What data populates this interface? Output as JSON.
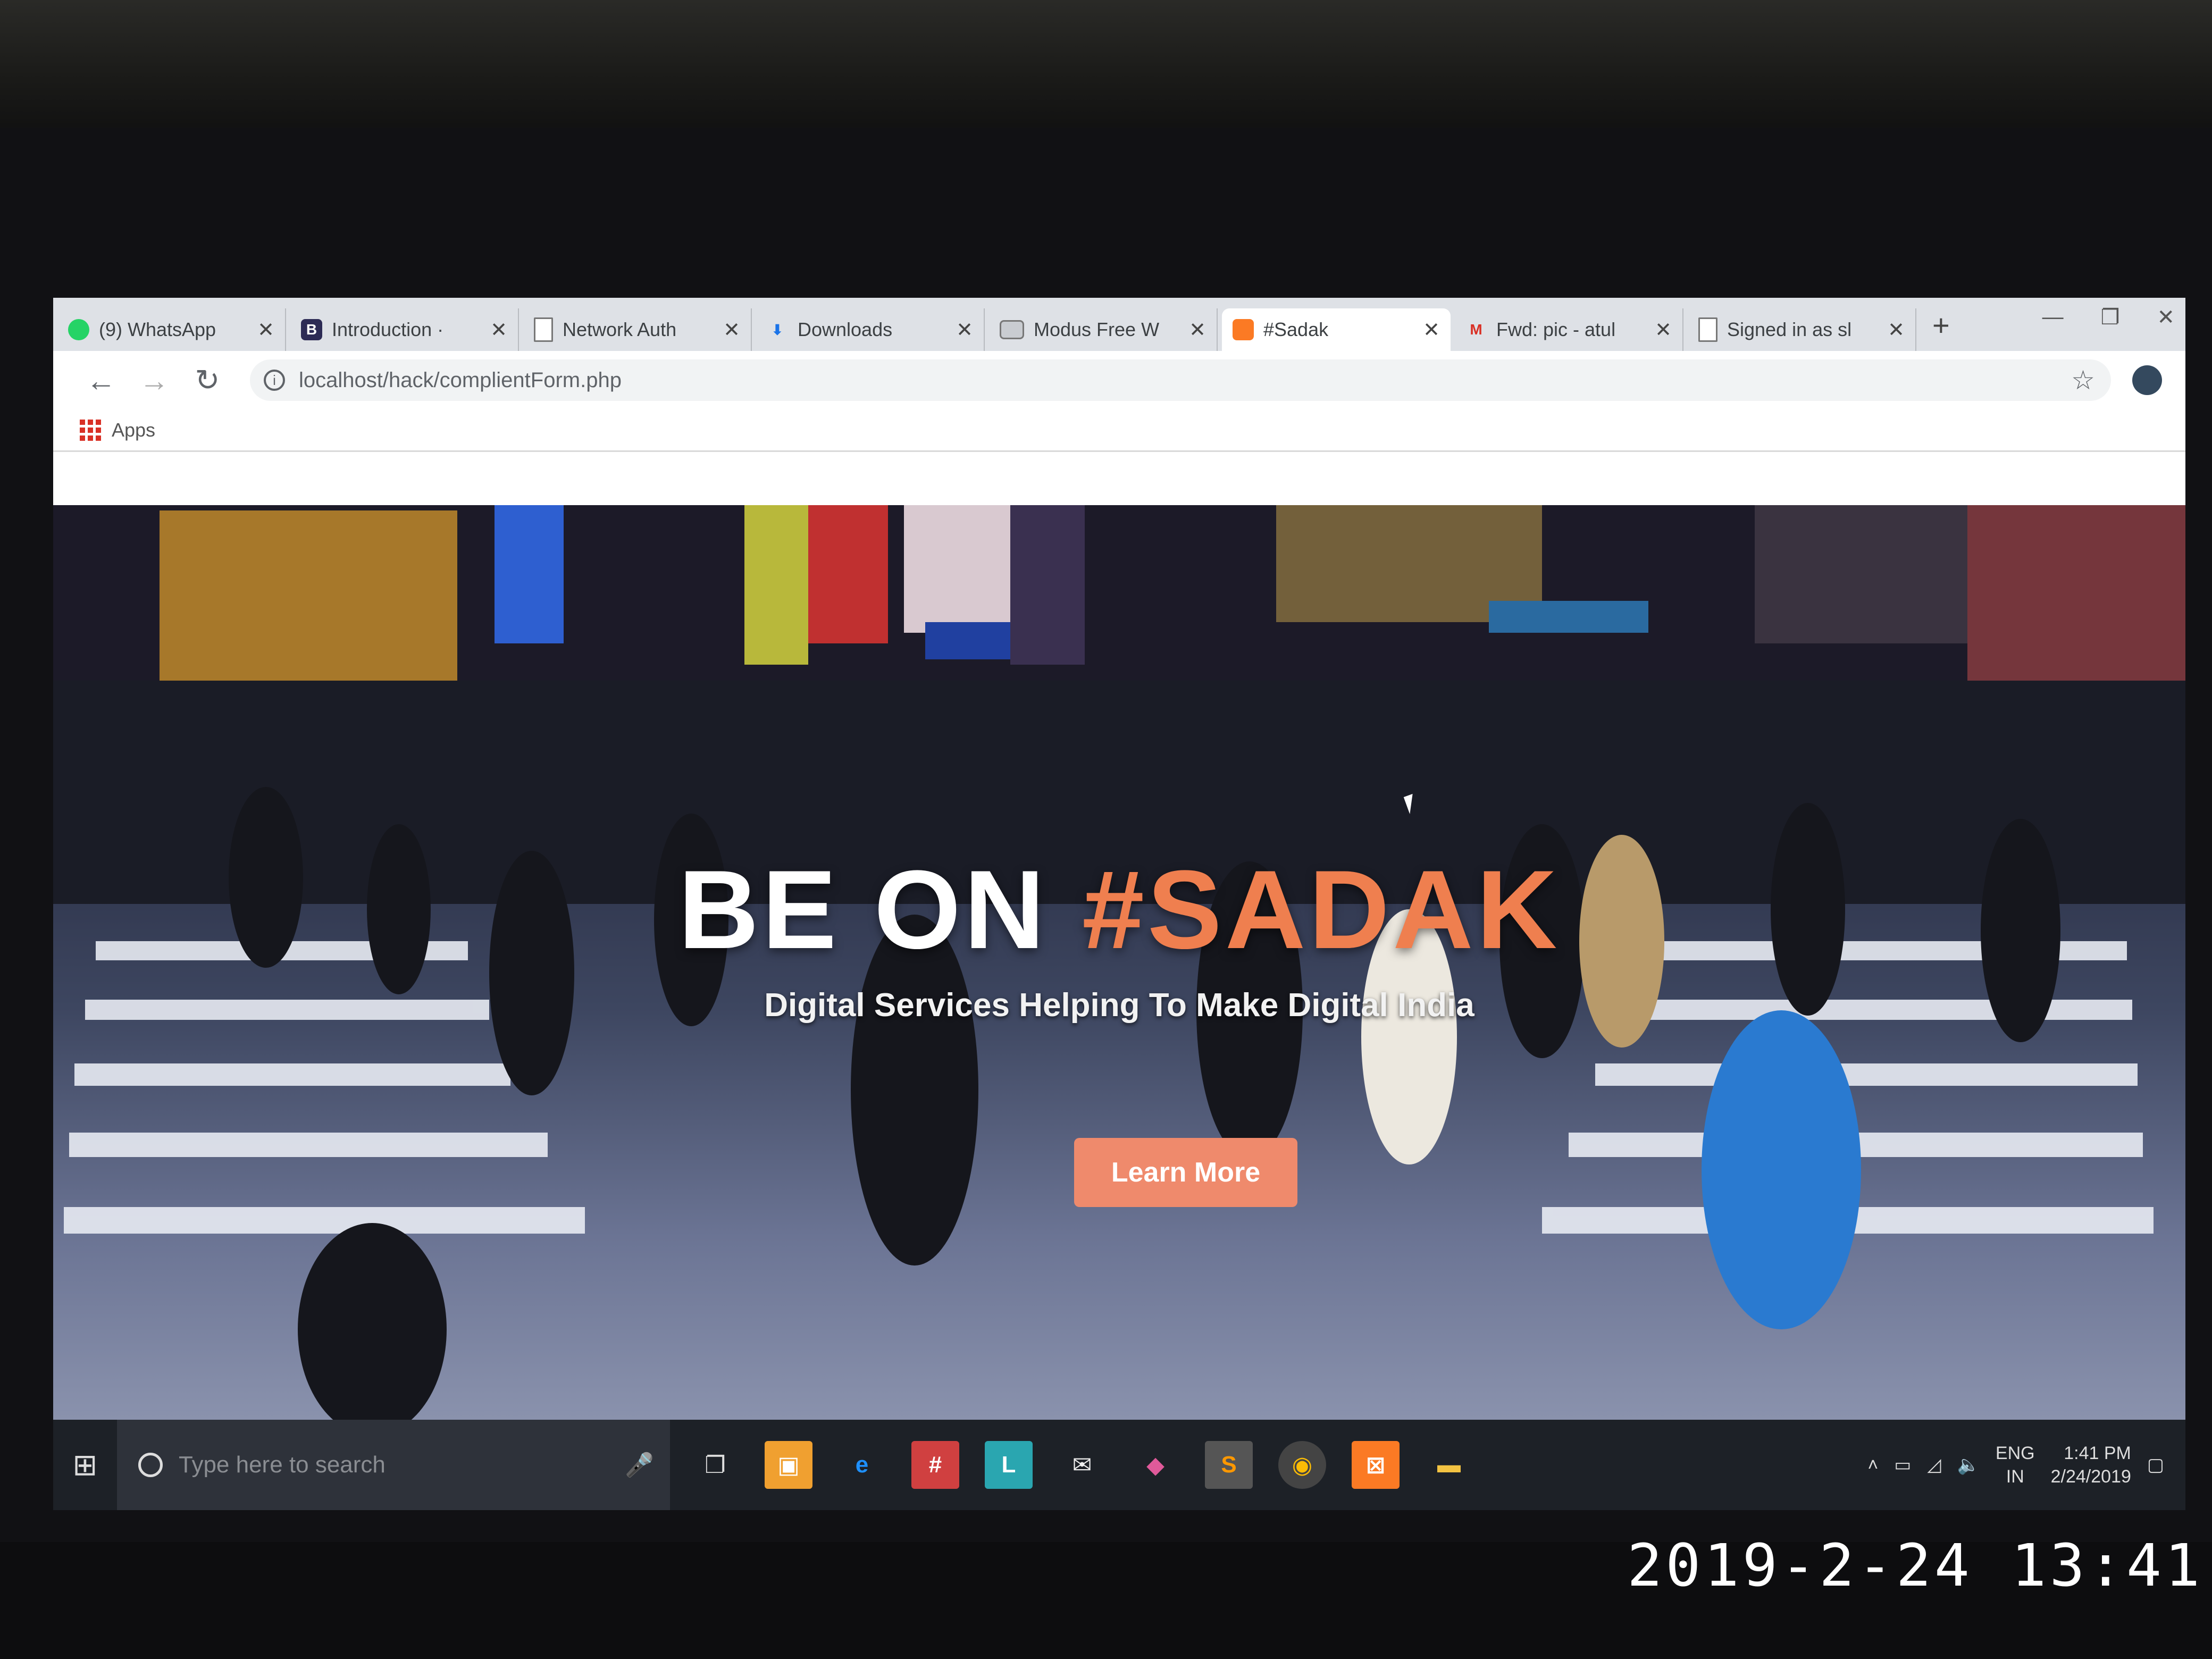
{
  "browser": {
    "tabs": [
      {
        "title": "(9) WhatsApp",
        "icon": "whatsapp-icon",
        "color": "#25d366",
        "glyph": "",
        "active": false
      },
      {
        "title": "Introduction ·",
        "icon": "bootstrap-icon",
        "color": "#2d2b55",
        "glyph": "B",
        "active": false
      },
      {
        "title": "Network Auth",
        "icon": "page-icon",
        "color": "#9aa0a6",
        "glyph": "",
        "active": false
      },
      {
        "title": "Downloads",
        "icon": "download-icon",
        "color": "#1a73e8",
        "glyph": "⬇",
        "active": false
      },
      {
        "title": "Modus Free W",
        "icon": "site-icon",
        "color": "#9aa0a6",
        "glyph": "",
        "active": false
      },
      {
        "title": "#Sadak",
        "icon": "xampp-icon",
        "color": "#fb7a24",
        "glyph": "",
        "active": true
      },
      {
        "title": "Fwd: pic - atul",
        "icon": "gmail-icon",
        "color": "#d93025",
        "glyph": "M",
        "active": false
      },
      {
        "title": "Signed in as sl",
        "icon": "page-icon",
        "color": "#9aa0a6",
        "glyph": "",
        "active": false
      }
    ],
    "new_tab": "+",
    "url": "localhost/hack/complientForm.php",
    "bookmarks_apps": "Apps"
  },
  "hero": {
    "title_white": "BE ON ",
    "title_accent": "#SADAK",
    "subtitle": "Digital Services Helping To Make Digital India",
    "button": "Learn More",
    "colors": {
      "accent": "#ef7f4f",
      "button_bg": "#ef8a6c"
    }
  },
  "taskbar": {
    "search_placeholder": "Type here to search",
    "language": "ENG",
    "region": "IN",
    "time": "1:41 PM",
    "date": "2/24/2019"
  },
  "photo_timestamp": "2019-2-24 13:41"
}
